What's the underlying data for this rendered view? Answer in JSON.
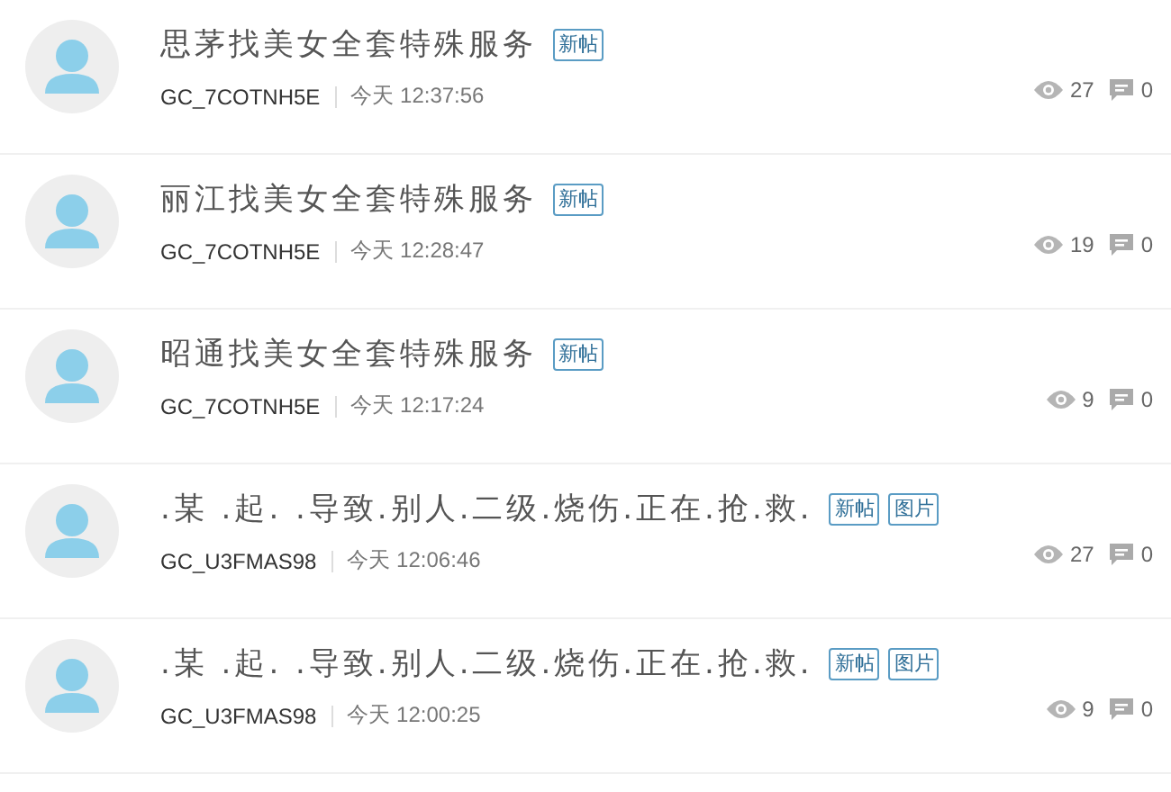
{
  "posts": [
    {
      "title": "思茅找美女全套特殊服务",
      "tags": [
        "新帖"
      ],
      "author": "GC_7COTNH5E",
      "time": "今天 12:37:56",
      "views": "27",
      "replies": "0"
    },
    {
      "title": "丽江找美女全套特殊服务",
      "tags": [
        "新帖"
      ],
      "author": "GC_7COTNH5E",
      "time": "今天 12:28:47",
      "views": "19",
      "replies": "0"
    },
    {
      "title": "昭通找美女全套特殊服务",
      "tags": [
        "新帖"
      ],
      "author": "GC_7COTNH5E",
      "time": "今天 12:17:24",
      "views": "9",
      "replies": "0"
    },
    {
      "title": ".某 .起. .导致.别人.二级.烧伤.正在.抢.救.",
      "tags": [
        "新帖",
        "图片"
      ],
      "author": "GC_U3FMAS98",
      "time": "今天 12:06:46",
      "views": "27",
      "replies": "0"
    },
    {
      "title": ".某 .起. .导致.别人.二级.烧伤.正在.抢.救.",
      "tags": [
        "新帖",
        "图片"
      ],
      "author": "GC_U3FMAS98",
      "time": "今天 12:00:25",
      "views": "9",
      "replies": "0"
    }
  ]
}
